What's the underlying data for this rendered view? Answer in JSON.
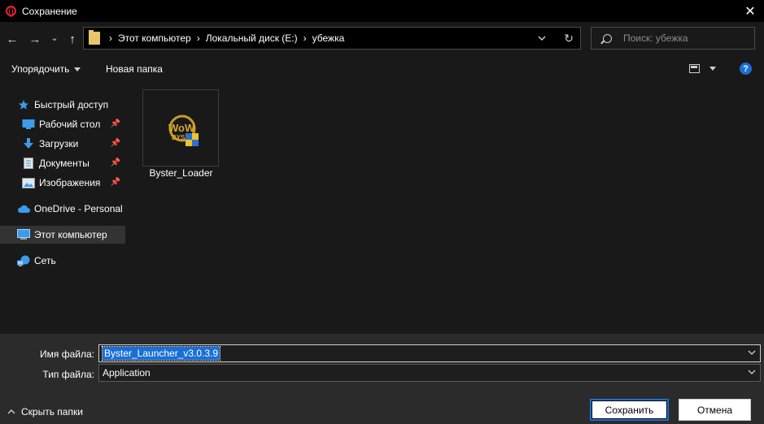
{
  "window": {
    "title": "Сохранение",
    "close_glyph": "✕"
  },
  "nav": {
    "back_glyph": "←",
    "forward_glyph": "→",
    "recent_glyph": "⌄",
    "up_glyph": "↑",
    "breadcrumbs": [
      "Этот компьютер",
      "Локальный диск (E:)",
      "убежка"
    ],
    "refresh_glyph": "↻"
  },
  "search": {
    "placeholder": "Поиск: убежка"
  },
  "toolbar": {
    "organize_label": "Упорядочить",
    "new_folder_label": "Новая папка",
    "help_glyph": "?"
  },
  "sidebar": {
    "items": [
      {
        "label": "Быстрый доступ",
        "icon": "star-icon"
      },
      {
        "label": "Рабочий стол",
        "icon": "desktop-icon",
        "pinned": true
      },
      {
        "label": "Загрузки",
        "icon": "downloads-icon",
        "pinned": true
      },
      {
        "label": "Документы",
        "icon": "documents-icon",
        "pinned": true
      },
      {
        "label": "Изображения",
        "icon": "pictures-icon",
        "pinned": true
      },
      {
        "label": "OneDrive - Personal",
        "icon": "onedrive-icon"
      },
      {
        "label": "Этот компьютер",
        "icon": "computer-icon",
        "selected": true
      },
      {
        "label": "Сеть",
        "icon": "network-icon"
      }
    ]
  },
  "files": [
    {
      "name": "Byster_Loader",
      "icon": "byster-app-icon"
    }
  ],
  "form": {
    "filename_label": "Имя файла:",
    "filename_value": "Byster_Launcher_v3.0.3.9",
    "filetype_label": "Тип файла:",
    "filetype_value": "Application"
  },
  "footer": {
    "hide_folders_label": "Скрыть папки",
    "save_label": "Сохранить",
    "cancel_label": "Отмена"
  },
  "colors": {
    "background": "#191919",
    "titlebar": "#000000",
    "bottom_panel": "#2b2b2b",
    "accent": "#1a6fd6",
    "opera_red": "#e8202b"
  }
}
